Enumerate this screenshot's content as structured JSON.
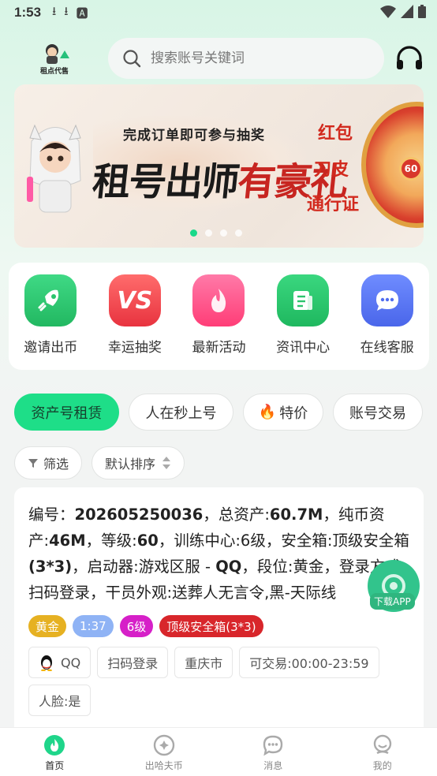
{
  "status_bar": {
    "time": "1:53"
  },
  "header": {
    "logo_text": "租点代售",
    "search_placeholder": "搜索账号关键词"
  },
  "banner": {
    "top_text": "完成订单即可参与抽奖",
    "main_text_a": "租号出师",
    "main_text_b": "有豪礼",
    "prizes": [
      "红包",
      "刀皮",
      "通行证"
    ],
    "wheel_center": "60",
    "slide_count": 4,
    "active_slide": 0
  },
  "quick_menu": [
    {
      "label": "邀请出币",
      "icon": "rocket-icon",
      "color": "#2fc872"
    },
    {
      "label": "幸运抽奖",
      "icon": "vs-icon",
      "color": "#f04b55"
    },
    {
      "label": "最新活动",
      "icon": "flame-icon",
      "color": "#ff4f8a"
    },
    {
      "label": "资讯中心",
      "icon": "news-icon",
      "color": "#2bcb6c"
    },
    {
      "label": "在线客服",
      "icon": "chat-icon",
      "color": "#5a78f2"
    }
  ],
  "tabs": [
    {
      "label": "资产号租赁",
      "active": true
    },
    {
      "label": "人在秒上号",
      "active": false
    },
    {
      "label": "特价",
      "active": false
    },
    {
      "label": "账号交易",
      "active": false
    }
  ],
  "filters": {
    "filter_label": "筛选",
    "sort_label": "默认排序"
  },
  "listing": {
    "desc_prefix": "编号：",
    "code": "202605250036",
    "desc_1": "，总资产:",
    "total_assets": "60.7M",
    "desc_2": "，纯币资产:",
    "pure_assets": "46M",
    "desc_3": "，等级:",
    "level": "60",
    "desc_4": "，训练中心:6级，安全箱:顶级安全箱",
    "safe_box": "(3*3)",
    "desc_5": "，启动器:游戏区服 - ",
    "server": "QQ",
    "desc_6": "，段位:黄金，登录方式:扫码登录，干员外观:送葬人无言令,黑-天际线",
    "badges": [
      {
        "text": "黄金",
        "color": "#e6b122"
      },
      {
        "text": "1:37",
        "color": "#8fb3f5"
      },
      {
        "text": "6级",
        "color": "#d620c8"
      },
      {
        "text": "顶级安全箱(3*3)",
        "color": "#d8262b"
      }
    ],
    "tags": [
      "QQ",
      "扫码登录",
      "重庆市",
      "可交易:00:00-23:59",
      "人脸:是"
    ]
  },
  "download": {
    "label": "下载APP"
  },
  "bottom_nav": [
    {
      "label": "首页",
      "icon": "home-flame-icon",
      "active": true
    },
    {
      "label": "出哈夫币",
      "icon": "coin-icon",
      "active": false
    },
    {
      "label": "消息",
      "icon": "message-icon",
      "active": false
    },
    {
      "label": "我的",
      "icon": "profile-icon",
      "active": false
    }
  ]
}
